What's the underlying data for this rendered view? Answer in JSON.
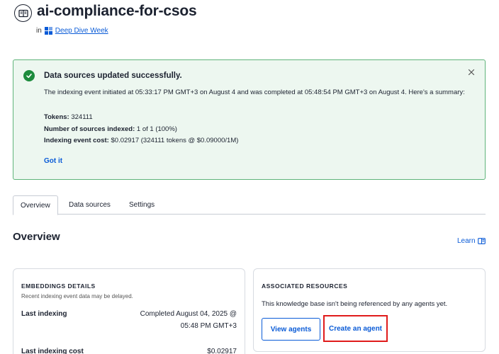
{
  "header": {
    "title": "ai-compliance-for-csos",
    "in_label": "in",
    "workspace": "Deep Dive Week"
  },
  "banner": {
    "title": "Data sources updated successfully.",
    "body": "The indexing event initiated at 05:33:17 PM GMT+3 on August 4 and was completed at 05:48:54 PM GMT+3 on August 4. Here's a summary:",
    "tokens_label": "Tokens:",
    "tokens_value": "324111",
    "sources_label": "Number of sources indexed:",
    "sources_value": "1 of 1 (100%)",
    "cost_label": "Indexing event cost:",
    "cost_value": "$0.02917 (324111 tokens @ $0.09000/1M)",
    "got_it": "Got it",
    "accent_color": "#1d8b3d"
  },
  "tabs": [
    {
      "label": "Overview",
      "active": true
    },
    {
      "label": "Data sources",
      "active": false
    },
    {
      "label": "Settings",
      "active": false
    }
  ],
  "overview": {
    "title": "Overview",
    "learn": "Learn"
  },
  "embeddings": {
    "heading": "EMBEDDINGS DETAILS",
    "subtext": "Recent indexing event data may be delayed.",
    "last_indexing_label": "Last indexing",
    "last_indexing_line1": "Completed August 04, 2025 @",
    "last_indexing_line2": "05:48 PM GMT+3",
    "last_cost_label": "Last indexing cost",
    "last_cost_value": "$0.02917"
  },
  "resources": {
    "heading": "ASSOCIATED RESOURCES",
    "text": "This knowledge base isn't being referenced by any agents yet.",
    "view_agents": "View agents",
    "create_agent": "Create an agent"
  }
}
